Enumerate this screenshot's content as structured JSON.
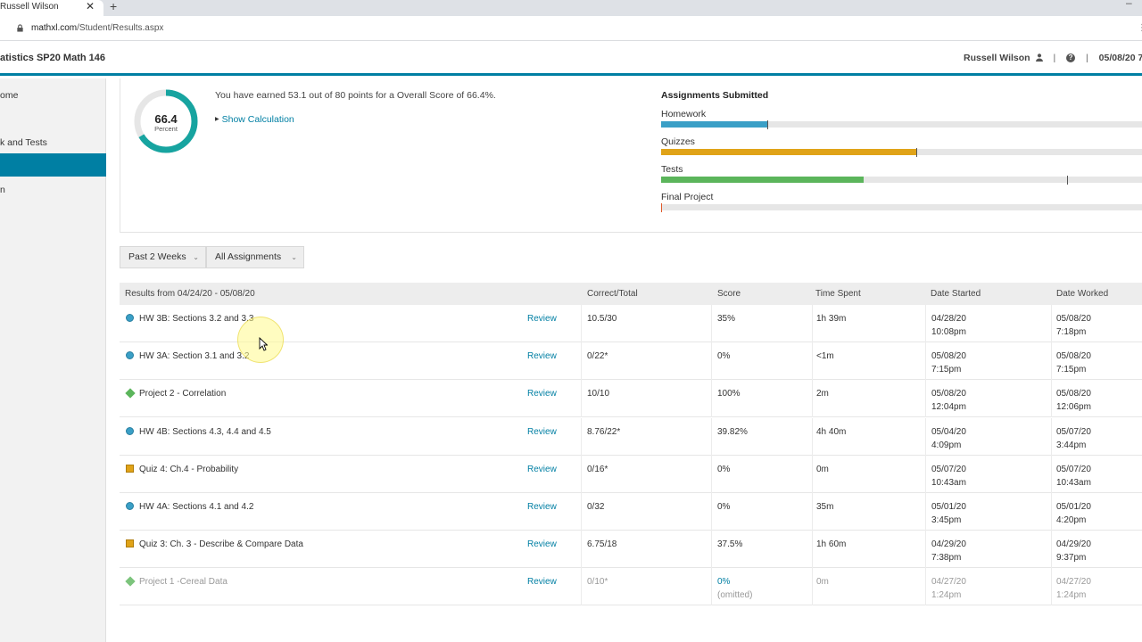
{
  "browser": {
    "tab_title": "Russell Wilson",
    "tab_close": "✕",
    "new_tab": "+",
    "minimize": "–",
    "url_host": "mathxl.com",
    "url_path": "/Student/Results.aspx"
  },
  "header": {
    "course_title": "atistics SP20 Math 146",
    "user_name": "Russell Wilson",
    "separator": "|",
    "date": "05/08/20 7"
  },
  "sidebar": {
    "items": [
      {
        "label": "ome"
      },
      {
        "label": "k and Tests"
      },
      {
        "label": ""
      },
      {
        "label": "n"
      }
    ]
  },
  "overview": {
    "score_value": "66.4",
    "score_label": "Percent",
    "score_fraction": 0.664,
    "earned_text": "You have earned 53.1 out of 80 points for a Overall Score of 66.4%.",
    "show_calculation": "Show Calculation",
    "submitted_title": "Assignments Submitted",
    "bars": [
      {
        "label": "Homework",
        "fill": 0.22,
        "color": "#3a9fc6",
        "marker": 0.22
      },
      {
        "label": "Quizzes",
        "fill": 0.53,
        "color": "#e0a318",
        "marker": 0.53
      },
      {
        "label": "Tests",
        "fill": 0.42,
        "color": "#5bb55b",
        "marker": 0.843
      },
      {
        "label": "Final Project",
        "fill": 0.0,
        "color": "#e05a2b",
        "marker": 0.0
      }
    ]
  },
  "filters": {
    "period": "Past 2 Weeks",
    "assignments": "All Assignments",
    "chevron": "⌄"
  },
  "table": {
    "headers": {
      "results": "Results from 04/24/20 - 05/08/20",
      "correct": "Correct/Total",
      "score": "Score",
      "time": "Time Spent",
      "started": "Date Started",
      "worked": "Date Worked"
    },
    "rows": [
      {
        "type": "hw",
        "name": "HW 3B: Sections 3.2 and 3.3",
        "review": "Review",
        "correct": "10.5/30",
        "score": "35%",
        "score2": "",
        "time": "1h 39m",
        "started1": "04/28/20",
        "started2": "10:08pm",
        "worked1": "05/08/20",
        "worked2": "7:18pm"
      },
      {
        "type": "hw",
        "name": "HW 3A: Section 3.1 and 3.2",
        "review": "Review",
        "correct": "0/22*",
        "score": "0%",
        "score2": "",
        "time": "<1m",
        "started1": "05/08/20",
        "started2": "7:15pm",
        "worked1": "05/08/20",
        "worked2": "7:15pm"
      },
      {
        "type": "proj",
        "name": "Project 2 - Correlation",
        "review": "Review",
        "correct": "10/10",
        "score": "100%",
        "score2": "",
        "time": "2m",
        "started1": "05/08/20",
        "started2": "12:04pm",
        "worked1": "05/08/20",
        "worked2": "12:06pm"
      },
      {
        "type": "hw",
        "name": "HW 4B: Sections 4.3, 4.4 and 4.5",
        "review": "Review",
        "correct": "8.76/22*",
        "score": "39.82%",
        "score2": "",
        "time": "4h 40m",
        "started1": "05/04/20",
        "started2": "4:09pm",
        "worked1": "05/07/20",
        "worked2": "3:44pm"
      },
      {
        "type": "quiz",
        "name": "Quiz 4: Ch.4 - Probability",
        "review": "Review",
        "correct": "0/16*",
        "score": "0%",
        "score2": "",
        "time": "0m",
        "started1": "05/07/20",
        "started2": "10:43am",
        "worked1": "05/07/20",
        "worked2": "10:43am"
      },
      {
        "type": "hw",
        "name": "HW 4A: Sections 4.1 and 4.2",
        "review": "Review",
        "correct": "0/32",
        "score": "0%",
        "score2": "",
        "time": "35m",
        "started1": "05/01/20",
        "started2": "3:45pm",
        "worked1": "05/01/20",
        "worked2": "4:20pm"
      },
      {
        "type": "quiz",
        "name": "Quiz 3: Ch. 3 - Describe & Compare Data",
        "review": "Review",
        "correct": "6.75/18",
        "score": "37.5%",
        "score2": "",
        "time": "1h 60m",
        "started1": "04/29/20",
        "started2": "7:38pm",
        "worked1": "04/29/20",
        "worked2": "9:37pm"
      },
      {
        "type": "proj",
        "name": "Project 1 -Cereal Data",
        "review": "Review",
        "correct": "0/10*",
        "score": "0%",
        "score2": "(omitted)",
        "time": "0m",
        "started1": "04/27/20",
        "started2": "1:24pm",
        "worked1": "04/27/20",
        "worked2": "1:24pm",
        "muted": true
      }
    ]
  }
}
